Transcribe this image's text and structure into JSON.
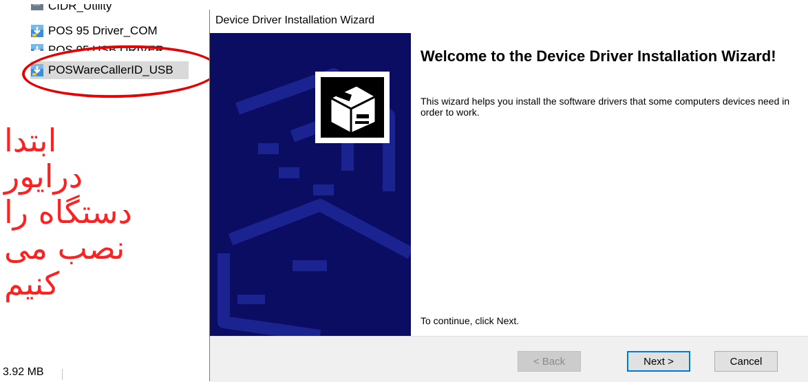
{
  "file_list": {
    "items": [
      {
        "name": "CIDR_Utility",
        "icon": "installer-icon"
      },
      {
        "name": "POS 95 Driver_COM",
        "icon": "installer-icon"
      },
      {
        "name": "POS 95 USB DRIVER",
        "icon": "installer-icon"
      },
      {
        "name": "POSWareCallerID_USB",
        "icon": "installer-icon",
        "selected": true
      }
    ],
    "status_size": "3.92 MB"
  },
  "annotation": {
    "lines": [
      "ابتدا",
      "درایور",
      "دستگاه را",
      "نصب می",
      "کنیم"
    ],
    "color": "#ff2020",
    "ellipse_color": "#e60000"
  },
  "wizard": {
    "title": "Device Driver Installation Wizard",
    "heading": "Welcome to the Device Driver Installation Wizard!",
    "description": "This wizard helps you install the software drivers that some computers devices need in order to work.",
    "continue_hint": "To continue, click Next.",
    "banner_color": "#0b0d63",
    "buttons": {
      "back": "< Back",
      "next": "Next >",
      "cancel": "Cancel"
    }
  }
}
